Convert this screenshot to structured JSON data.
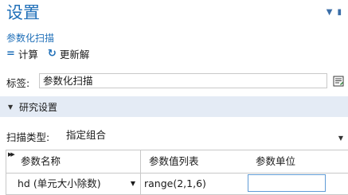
{
  "header": {
    "title": "设置",
    "subtitle": "参数化扫描"
  },
  "toolbar": {
    "compute_label": "计算",
    "update_label": "更新解"
  },
  "label_row": {
    "label": "标签:",
    "value": "参数化扫描"
  },
  "section": {
    "label": "研究设置"
  },
  "sweep": {
    "label": "扫描类型:",
    "value": "指定组合"
  },
  "table": {
    "headers": [
      "参数名称",
      "参数值列表",
      "参数单位"
    ],
    "rows": [
      {
        "param": "hd (单元大小除数)",
        "values": "range(2,1,6)",
        "unit": ""
      }
    ]
  }
}
